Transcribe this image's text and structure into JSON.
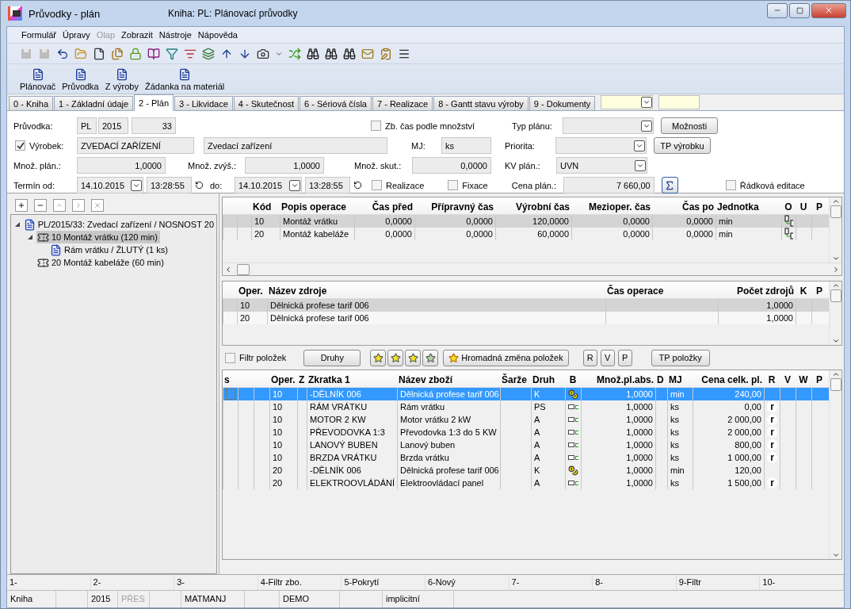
{
  "window": {
    "title": "Průvodky - plán",
    "subtitle": "Kniha: PL: Plánovací průvodky"
  },
  "menu": [
    {
      "label": "Formulář",
      "disabled": false
    },
    {
      "label": "Úpravy",
      "disabled": false
    },
    {
      "label": "Olap",
      "disabled": true
    },
    {
      "label": "Zobrazit",
      "disabled": false
    },
    {
      "label": "Nástroje",
      "disabled": false
    },
    {
      "label": "Nápověda",
      "disabled": false
    }
  ],
  "toolbar": [
    {
      "kind": "save",
      "disabled": true
    },
    {
      "kind": "save_all",
      "disabled": true
    },
    {
      "kind": "undo",
      "disabled": false
    },
    {
      "kind": "folder",
      "disabled": false
    },
    {
      "kind": "page",
      "disabled": false
    },
    {
      "kind": "pages",
      "disabled": false
    },
    {
      "kind": "lock",
      "disabled": false
    },
    {
      "kind": "book",
      "disabled": false
    },
    {
      "kind": "filter",
      "disabled": false
    },
    {
      "kind": "filter_list",
      "disabled": false
    },
    {
      "kind": "layers",
      "disabled": false
    },
    {
      "kind": "up",
      "disabled": false
    },
    {
      "kind": "down",
      "disabled": false
    },
    {
      "kind": "camera",
      "disabled": false
    },
    {
      "kind": "caret",
      "disabled": false
    },
    {
      "kind": "shuffle",
      "disabled": false
    },
    {
      "kind": "binoculars",
      "disabled": false
    },
    {
      "kind": "binoculars",
      "disabled": false
    },
    {
      "kind": "binoculars",
      "disabled": false
    },
    {
      "kind": "mail",
      "disabled": false
    },
    {
      "kind": "clipboard",
      "disabled": false
    },
    {
      "kind": "menu",
      "disabled": false
    }
  ],
  "actions": [
    "Plánovač",
    "Průvodka",
    "Z výroby",
    "Žádanka na materiál"
  ],
  "tabs": [
    {
      "label": "0 - Kniha",
      "selected": false
    },
    {
      "label": "1 - Základní údaje",
      "selected": false
    },
    {
      "label": "2 - Plán",
      "selected": true
    },
    {
      "label": "3 - Likvidace",
      "selected": false
    },
    {
      "label": "4 - Skutečnost",
      "selected": false
    },
    {
      "label": "6 - Sériová čísla",
      "selected": false
    },
    {
      "label": "7 - Realizace",
      "selected": false
    },
    {
      "label": "8 - Gantt stavu výroby",
      "selected": false
    },
    {
      "label": "9 - Dokumenty",
      "selected": false
    }
  ],
  "form": {
    "pruvodka": {
      "label": "Průvodka:",
      "book": "PL",
      "year": "2015",
      "number": "33"
    },
    "zb_cas": {
      "label": "Zb. čas podle množství",
      "checked": false
    },
    "typ_planu": {
      "label": "Typ plánu:"
    },
    "moznosti": "Možnosti",
    "vyrobek": {
      "label": "Výrobek:",
      "checked": true,
      "code": "ZVEDACÍ ZAŘÍZENÍ",
      "name": "Zvedací zařízení"
    },
    "mj": {
      "label": "MJ:",
      "value": "ks"
    },
    "priorita": {
      "label": "Priorita:"
    },
    "tp_vyrobku": "TP výrobku",
    "mnoz_plan": {
      "label": "Množ. plán.:",
      "value": "1,0000"
    },
    "mnoz_zvys": {
      "label": "Množ. zvýš.:",
      "value": "1,0000"
    },
    "mnoz_skut": {
      "label": "Množ. skut.:",
      "value": "0,0000"
    },
    "kv_plan": {
      "label": "KV plán.:",
      "value": "UVN"
    },
    "termin_od": {
      "label": "Termín od:",
      "date": "14.10.2015",
      "time": "13:28:55"
    },
    "termin_do": {
      "label": "do:",
      "date": "14.10.2015",
      "time": "13:28:55"
    },
    "realizace": {
      "label": "Realizace",
      "checked": false
    },
    "fixace": {
      "label": "Fixace",
      "checked": false
    },
    "cena_plan": {
      "label": "Cena plán.:",
      "value": "7 660,00"
    },
    "radkova": {
      "label": "Řádková editace",
      "checked": false
    }
  },
  "tree": [
    {
      "label": "PL/2015/33: Zvedací zařízení / NOSNOST 20",
      "kind": "document",
      "selected": false,
      "expanded": true,
      "children": [
        {
          "label": "10 Montáž vrátku (120 min)",
          "kind": "operation",
          "selected": true,
          "expanded": true,
          "children": [
            {
              "label": "Rám vrátku / ŽLUTÝ (1 ks)",
              "kind": "document",
              "selected": false
            }
          ]
        },
        {
          "label": "20 Montáž kabeláže (60 min)",
          "kind": "operation",
          "selected": false
        }
      ]
    }
  ],
  "operations": {
    "columns": [
      "Kód",
      "Popis operace",
      "Čas před",
      "Přípravný čas",
      "Výrobní čas",
      "Mezioper. čas",
      "Čas po",
      "Jednotka",
      "O",
      "U",
      "P"
    ],
    "rows": [
      {
        "selected": true,
        "code": "10",
        "description": "Montáž vrátku",
        "time_before": "0,0000",
        "prep_time": "0,0000",
        "prod_time": "120,0000",
        "interop_time": "0,0000",
        "time_after": "0,0000",
        "unit": "min",
        "linked": true
      },
      {
        "selected": false,
        "code": "20",
        "description": "Montáž kabeláže",
        "time_before": "0,0000",
        "prep_time": "0,0000",
        "prod_time": "60,0000",
        "interop_time": "0,0000",
        "time_after": "0,0000",
        "unit": "min",
        "linked": true
      }
    ]
  },
  "resources": {
    "columns": [
      "Oper.",
      "Název zdroje",
      "Čas operace",
      "Počet zdrojů",
      "K",
      "P"
    ],
    "rows": [
      {
        "selected": true,
        "oper": "10",
        "name": "Dělnická profese tarif 006",
        "count": "1,0000"
      },
      {
        "selected": false,
        "oper": "20",
        "name": "Dělnická profese tarif 006",
        "count": "1,0000"
      }
    ]
  },
  "items_toolbar": {
    "filter": {
      "label": "Filtr položek",
      "checked": false
    },
    "druhy": "Druhy",
    "bulk": "Hromadná změna položek",
    "letters": [
      "R",
      "V",
      "P"
    ],
    "tp": "TP položky"
  },
  "items": {
    "columns": [
      "s",
      "Oper.",
      "Z",
      "Zkratka 1",
      "Název zboží",
      "Šarže",
      "Druh",
      "B",
      "Množ.pl.abs.",
      "D",
      "MJ",
      "Cena celk. pl.",
      "R",
      "V",
      "W",
      "P"
    ],
    "rows": [
      {
        "selected": true,
        "oper": "10",
        "abbr": "-DĚLNÍK 006",
        "name": "Dělnická profese tarif 006",
        "type": "K",
        "kind": "workers",
        "qty": "1,0000",
        "unit": "min",
        "price": "240,00"
      },
      {
        "selected": false,
        "oper": "10",
        "abbr": "RÁM VRÁTKU",
        "name": "Rám vrátku",
        "type": "PS",
        "kind": "part",
        "qty": "1,0000",
        "unit": "ks",
        "price": "0,00",
        "r": "r"
      },
      {
        "selected": false,
        "oper": "10",
        "abbr": "MOTOR 2 KW",
        "name": "Motor vrátku 2 kW",
        "type": "A",
        "kind": "part",
        "qty": "1,0000",
        "unit": "ks",
        "price": "2 000,00",
        "r": "r"
      },
      {
        "selected": false,
        "oper": "10",
        "abbr": "PŘEVODOVKA 1:3",
        "name": "Převodovka 1:3 do 5 KW",
        "type": "A",
        "kind": "part",
        "qty": "1,0000",
        "unit": "ks",
        "price": "2 000,00",
        "r": "r"
      },
      {
        "selected": false,
        "oper": "10",
        "abbr": "LANOVÝ BUBEN",
        "name": "Lanový buben",
        "type": "A",
        "kind": "part",
        "qty": "1,0000",
        "unit": "ks",
        "price": "800,00",
        "r": "r"
      },
      {
        "selected": false,
        "oper": "10",
        "abbr": "BRZDA VRÁTKU",
        "name": "Brzda vrátku",
        "type": "A",
        "kind": "part",
        "qty": "1,0000",
        "unit": "ks",
        "price": "1 000,00",
        "r": "r"
      },
      {
        "selected": false,
        "oper": "20",
        "abbr": "-DĚLNÍK 006",
        "name": "Dělnická profese tarif 006",
        "type": "K",
        "kind": "workers",
        "qty": "1,0000",
        "unit": "min",
        "price": "120,00"
      },
      {
        "selected": false,
        "oper": "20",
        "abbr": "ELEKTROOVLÁDÁNÍ",
        "name": "Elektroovládací panel",
        "type": "A",
        "kind": "part",
        "qty": "1,0000",
        "unit": "ks",
        "price": "1 500,00",
        "r": "r"
      }
    ]
  },
  "function_keys": [
    "1-",
    "2-",
    "3-",
    "4-Filtr zbo.",
    "5-Pokrytí",
    "6-Nový",
    "7-",
    "8-",
    "9-Filtr",
    "10-"
  ],
  "status_bar": [
    {
      "text": "Kniha",
      "disabled": false
    },
    {
      "text": "2015",
      "disabled": false
    },
    {
      "text": "PŘES",
      "disabled": true
    },
    {
      "text": "MATMANJ",
      "disabled": false
    },
    {
      "text": "DEMO",
      "disabled": false
    },
    {
      "text": "implicitní",
      "disabled": false
    }
  ]
}
